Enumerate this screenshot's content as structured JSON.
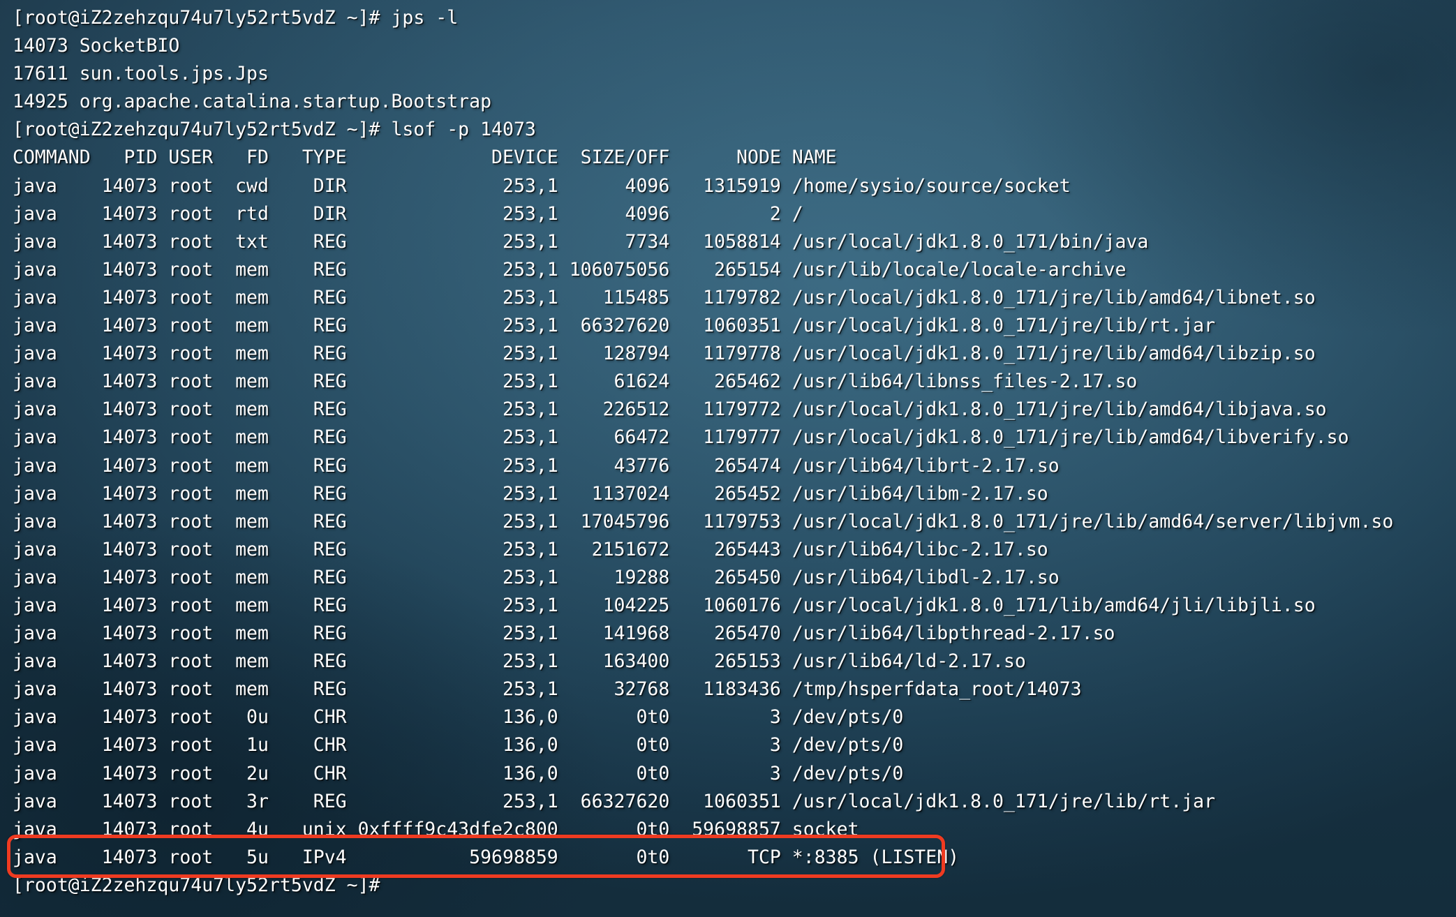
{
  "terminal": {
    "title": "lsof -p 14073 output",
    "prompt": "[root@iZ2zehzqu74u7ly52rt5vdZ ~]#",
    "background_color": "#2b556d",
    "text_color": "#ffffff",
    "highlight_color": "#ef3b21",
    "lines": [
      "[root@iZ2zehzqu74u7ly52rt5vdZ ~]# jps -l",
      "14073 SocketBIO",
      "17611 sun.tools.jps.Jps",
      "14925 org.apache.catalina.startup.Bootstrap",
      "[root@iZ2zehzqu74u7ly52rt5vdZ ~]# lsof -p 14073",
      "COMMAND   PID USER   FD   TYPE             DEVICE  SIZE/OFF      NODE NAME",
      "java    14073 root  cwd    DIR              253,1      4096   1315919 /home/sysio/source/socket",
      "java    14073 root  rtd    DIR              253,1      4096         2 /",
      "java    14073 root  txt    REG              253,1      7734   1058814 /usr/local/jdk1.8.0_171/bin/java",
      "java    14073 root  mem    REG              253,1 106075056    265154 /usr/lib/locale/locale-archive",
      "java    14073 root  mem    REG              253,1    115485   1179782 /usr/local/jdk1.8.0_171/jre/lib/amd64/libnet.so",
      "java    14073 root  mem    REG              253,1  66327620   1060351 /usr/local/jdk1.8.0_171/jre/lib/rt.jar",
      "java    14073 root  mem    REG              253,1    128794   1179778 /usr/local/jdk1.8.0_171/jre/lib/amd64/libzip.so",
      "java    14073 root  mem    REG              253,1     61624    265462 /usr/lib64/libnss_files-2.17.so",
      "java    14073 root  mem    REG              253,1    226512   1179772 /usr/local/jdk1.8.0_171/jre/lib/amd64/libjava.so",
      "java    14073 root  mem    REG              253,1     66472   1179777 /usr/local/jdk1.8.0_171/jre/lib/amd64/libverify.so",
      "java    14073 root  mem    REG              253,1     43776    265474 /usr/lib64/librt-2.17.so",
      "java    14073 root  mem    REG              253,1   1137024    265452 /usr/lib64/libm-2.17.so",
      "java    14073 root  mem    REG              253,1  17045796   1179753 /usr/local/jdk1.8.0_171/jre/lib/amd64/server/libjvm.so",
      "java    14073 root  mem    REG              253,1   2151672    265443 /usr/lib64/libc-2.17.so",
      "java    14073 root  mem    REG              253,1     19288    265450 /usr/lib64/libdl-2.17.so",
      "java    14073 root  mem    REG              253,1    104225   1060176 /usr/local/jdk1.8.0_171/lib/amd64/jli/libjli.so",
      "java    14073 root  mem    REG              253,1    141968    265470 /usr/lib64/libpthread-2.17.so",
      "java    14073 root  mem    REG              253,1    163400    265153 /usr/lib64/ld-2.17.so",
      "java    14073 root  mem    REG              253,1     32768   1183436 /tmp/hsperfdata_root/14073",
      "java    14073 root   0u    CHR              136,0       0t0         3 /dev/pts/0",
      "java    14073 root   1u    CHR              136,0       0t0         3 /dev/pts/0",
      "java    14073 root   2u    CHR              136,0       0t0         3 /dev/pts/0",
      "java    14073 root   3r    REG              253,1  66327620   1060351 /usr/local/jdk1.8.0_171/jre/lib/rt.jar",
      "java    14073 root   4u   unix 0xffff9c43dfe2c800       0t0  59698857 socket",
      "java    14073 root   5u   IPv4           59698859       0t0       TCP *:8385 (LISTEN)",
      "[root@iZ2zehzqu74u7ly52rt5vdZ ~]#"
    ],
    "highlight": {
      "label": "listening-socket-highlight",
      "line_index": 30,
      "text": "java    14073 root   5u   IPv4           59698859       0t0       TCP *:8385 (LISTEN)"
    },
    "commands": [
      {
        "name": "jps",
        "args": "-l"
      },
      {
        "name": "lsof",
        "args": "-p 14073"
      }
    ],
    "columns": [
      "COMMAND",
      "PID",
      "USER",
      "FD",
      "TYPE",
      "DEVICE",
      "SIZE/OFF",
      "NODE",
      "NAME"
    ]
  }
}
